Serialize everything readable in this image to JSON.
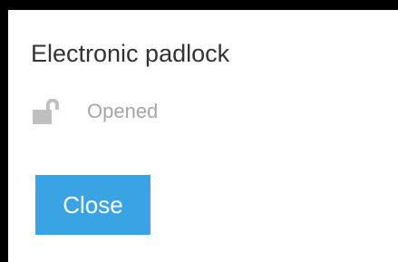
{
  "dialog": {
    "title": "Electronic padlock",
    "status": {
      "icon": "unlocked-padlock-icon",
      "text": "Opened"
    },
    "close_label": "Close"
  },
  "colors": {
    "frame": "#000000",
    "background": "#ffffff",
    "title_text": "#333333",
    "status_text": "#a6a6a6",
    "icon": "#bfbfbf",
    "button": "#3aa3e3",
    "button_text": "#ffffff"
  }
}
